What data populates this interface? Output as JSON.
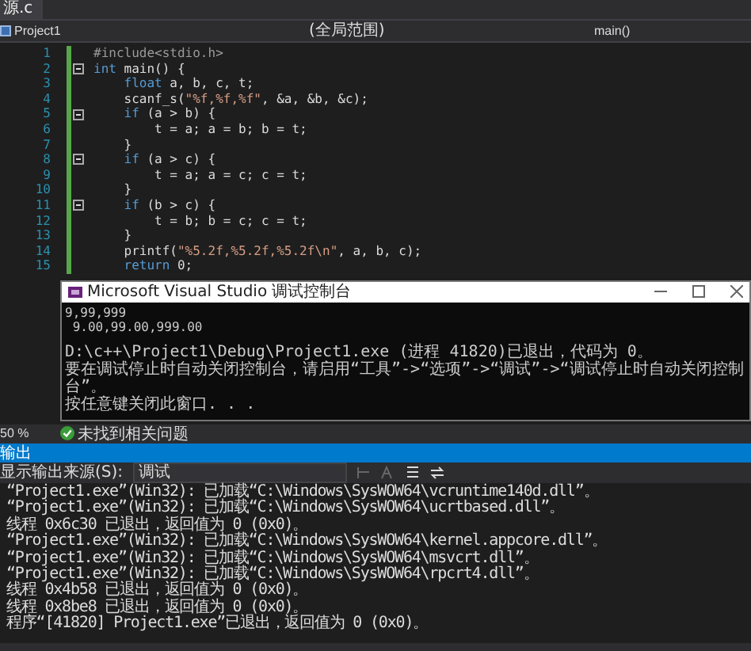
{
  "tab": {
    "title": "源.c"
  },
  "nav": {
    "project": "Project1",
    "scope": "(全局范围)",
    "member": "main()"
  },
  "editor": {
    "lines": [
      {
        "number": "1",
        "fold": false,
        "tokens": [
          {
            "text": "#include<stdio.h>",
            "kind": "preproc"
          }
        ]
      },
      {
        "number": "2",
        "fold": true,
        "tokens": [
          {
            "text": "int",
            "kind": "keyword"
          },
          {
            "text": " main() {",
            "kind": "plain"
          }
        ]
      },
      {
        "number": "3",
        "fold": false,
        "tokens": [
          {
            "text": "    float",
            "kind": "keyword"
          },
          {
            "text": " a, b, c, t;",
            "kind": "plain"
          }
        ]
      },
      {
        "number": "4",
        "fold": false,
        "tokens": [
          {
            "text": "    scanf_s(",
            "kind": "plain"
          },
          {
            "text": "\"%f,%f,%f\"",
            "kind": "string"
          },
          {
            "text": ", &a, &b, &c);",
            "kind": "plain"
          }
        ]
      },
      {
        "number": "5",
        "fold": true,
        "tokens": [
          {
            "text": "    if",
            "kind": "keyword"
          },
          {
            "text": " (a > b) {",
            "kind": "plain"
          }
        ]
      },
      {
        "number": "6",
        "fold": false,
        "tokens": [
          {
            "text": "        t = a; a = b; b = t;",
            "kind": "plain"
          }
        ]
      },
      {
        "number": "7",
        "fold": false,
        "tokens": [
          {
            "text": "    }",
            "kind": "plain"
          }
        ]
      },
      {
        "number": "8",
        "fold": true,
        "tokens": [
          {
            "text": "    if",
            "kind": "keyword"
          },
          {
            "text": " (a > c) {",
            "kind": "plain"
          }
        ]
      },
      {
        "number": "9",
        "fold": false,
        "tokens": [
          {
            "text": "        t = a; a = c; c = t;",
            "kind": "plain"
          }
        ]
      },
      {
        "number": "10",
        "fold": false,
        "tokens": [
          {
            "text": "    }",
            "kind": "plain"
          }
        ]
      },
      {
        "number": "11",
        "fold": true,
        "tokens": [
          {
            "text": "    if",
            "kind": "keyword"
          },
          {
            "text": " (b > c) {",
            "kind": "plain"
          }
        ]
      },
      {
        "number": "12",
        "fold": false,
        "tokens": [
          {
            "text": "        t = b; b = c; c = t;",
            "kind": "plain"
          }
        ]
      },
      {
        "number": "13",
        "fold": false,
        "tokens": [
          {
            "text": "    }",
            "kind": "plain"
          }
        ]
      },
      {
        "number": "14",
        "fold": false,
        "tokens": [
          {
            "text": "    printf(",
            "kind": "plain"
          },
          {
            "text": "\"%5.2f,%5.2f,%5.2f\\n\"",
            "kind": "string"
          },
          {
            "text": ", a, b, c);",
            "kind": "plain"
          }
        ]
      },
      {
        "number": "15",
        "fold": false,
        "tokens": [
          {
            "text": "    return",
            "kind": "keyword"
          },
          {
            "text": " 0;",
            "kind": "plain"
          }
        ]
      }
    ]
  },
  "console": {
    "title": "Microsoft Visual Studio 调试控制台",
    "program_output": [
      "9,99,999",
      " 9.00,99.00,999.00"
    ],
    "messages": [
      "D:\\c++\\Project1\\Debug\\Project1.exe (进程 41820)已退出，代码为 0。",
      "要在调试停止时自动关闭控制台，请启用“工具”->“选项”->“调试”->“调试停止时自动关闭控制台”。",
      "按任意键关闭此窗口. . ."
    ]
  },
  "status": {
    "zoom": "50 %",
    "issues": "未找到相关问题"
  },
  "output": {
    "title": "输出",
    "source_label": "显示输出来源(S):",
    "source": "调试",
    "lines": [
      "“Project1.exe”(Win32): 已加载“C:\\Windows\\SysWOW64\\vcruntime140d.dll”。",
      "“Project1.exe”(Win32): 已加载“C:\\Windows\\SysWOW64\\ucrtbased.dll”。",
      "线程 0x6c30 已退出，返回值为 0 (0x0)。",
      "“Project1.exe”(Win32): 已加载“C:\\Windows\\SysWOW64\\kernel.appcore.dll”。",
      "“Project1.exe”(Win32): 已加载“C:\\Windows\\SysWOW64\\msvcrt.dll”。",
      "“Project1.exe”(Win32): 已加载“C:\\Windows\\SysWOW64\\rpcrt4.dll”。",
      "线程 0x4b58 已退出，返回值为 0 (0x0)。",
      "线程 0x8be8 已退出，返回值为 0 (0x0)。",
      "程序“[41820] Project1.exe”已退出，返回值为 0 (0x0)。"
    ]
  }
}
